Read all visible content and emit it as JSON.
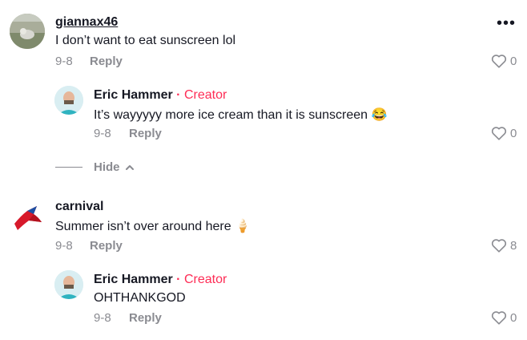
{
  "comments": [
    {
      "username": "giannax46",
      "text": "I don’t want to eat sunscreen lol",
      "date": "9-8",
      "reply_label": "Reply",
      "likes": "0",
      "replies": [
        {
          "username": "Eric Hammer",
          "badge": "Creator",
          "text": "It’s wayyyyy more ice cream than it is sunscreen 😂",
          "date": "9-8",
          "reply_label": "Reply",
          "likes": "0"
        }
      ],
      "hide_label": "Hide"
    },
    {
      "username": "carnival",
      "text": "Summer isn’t over around here 🍦",
      "date": "9-8",
      "reply_label": "Reply",
      "likes": "8",
      "replies": [
        {
          "username": "Eric Hammer",
          "badge": "Creator",
          "text": "OHTHANKGOD",
          "date": "9-8",
          "reply_label": "Reply",
          "likes": "0"
        }
      ]
    }
  ],
  "colors": {
    "accent": "#fe2c55",
    "muted": "#8a8b91",
    "text": "#161823"
  }
}
